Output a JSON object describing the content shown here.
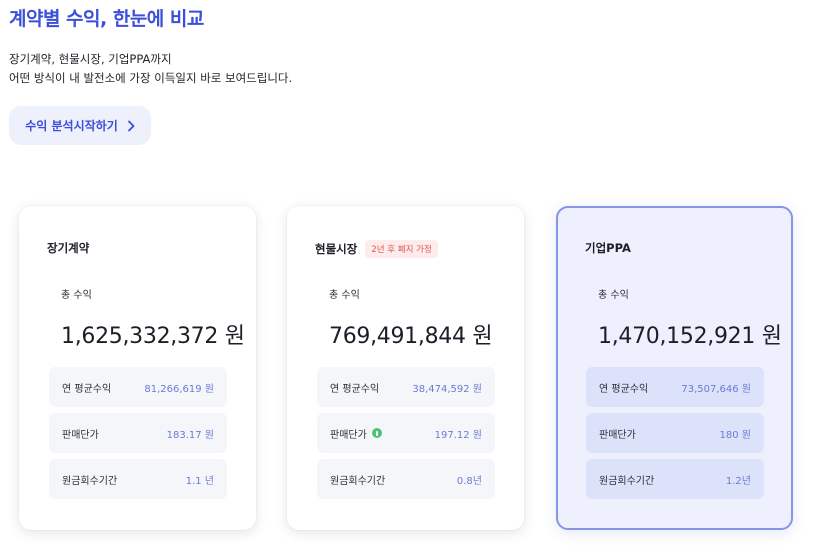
{
  "header": {
    "title": "계약별 수익, 한눈에 비교",
    "description_line1": "장기계약, 현물시장, 기업PPA까지",
    "description_line2": "어떤 방식이 내 발전소에 가장 이득일지 바로 보여드립니다."
  },
  "cta": {
    "label": "수익 분석시작하기",
    "icon": "chevron-right-icon",
    "color": "#3b4fd8"
  },
  "colors": {
    "accent": "#3b4fd8",
    "highlight_border": "#8595e8",
    "badge_text": "#e0574d",
    "info_dot": "#4fc17b"
  },
  "cards": [
    {
      "title": "장기계약",
      "total_label": "총 수익",
      "total_value": "1,625,332,372 원",
      "stats": [
        {
          "label": "연 평균수익",
          "value": "81,266,619 원"
        },
        {
          "label": "판매단가",
          "value": "183.17 원"
        },
        {
          "label": "원금회수기간",
          "value": "1.1 년"
        }
      ]
    },
    {
      "title": "현물시장",
      "badge": "2년 후 폐지 가정",
      "total_label": "총 수익",
      "total_value": "769,491,844 원",
      "stats": [
        {
          "label": "연 평균수익",
          "value": "38,474,592 원"
        },
        {
          "label": "판매단가",
          "value": "197.12 원",
          "icon": "info-icon"
        },
        {
          "label": "원금회수기간",
          "value": "0.8년"
        }
      ]
    },
    {
      "title": "기업PPA",
      "total_label": "총 수익",
      "total_value": "1,470,152,921 원",
      "stats": [
        {
          "label": "연 평균수익",
          "value": "73,507,646 원"
        },
        {
          "label": "판매단가",
          "value": "180 원"
        },
        {
          "label": "원금회수기간",
          "value": "1.2년"
        }
      ]
    }
  ]
}
